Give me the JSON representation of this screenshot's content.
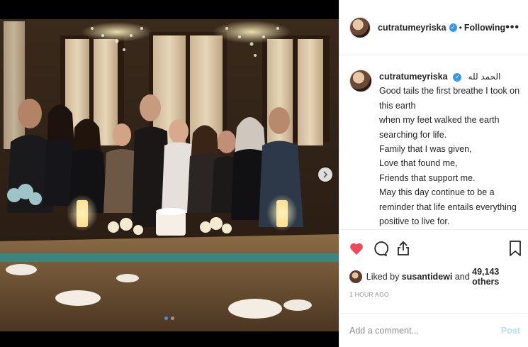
{
  "post": {
    "username": "cutratumeyriska",
    "follow_status": "Following",
    "separator": "•",
    "more_label": "•••",
    "verified_mark": "✓"
  },
  "caption": {
    "username": "cutratumeyriska",
    "arabic": "الحمد لله",
    "lines": [
      "Good tails the first breathe I took on",
      "this earth",
      "when my feet walked the earth",
      "searching for life.",
      "Family that I was given,",
      "Love that found me,",
      "Friends that support me.",
      "May this day continue to be a",
      "reminder that life entails everything",
      "positive to live for."
    ]
  },
  "likes": {
    "prefix": "Liked by ",
    "user": "susantidewi",
    "middle": " and ",
    "others": "49,143 others"
  },
  "timestamp": "1 HOUR AGO",
  "comment": {
    "placeholder": "Add a comment...",
    "post_label": "Post"
  },
  "carousel": {
    "slides": 2,
    "active": 0
  },
  "icons": {
    "like": "heart-icon",
    "comment": "comment-icon",
    "share": "share-icon",
    "save": "bookmark-icon",
    "next": "chevron-right-icon"
  },
  "colors": {
    "like_red": "#ed4956",
    "verified_blue": "#3897f0",
    "post_disabled": "#b2dffc",
    "muted": "#8e8e8e"
  }
}
